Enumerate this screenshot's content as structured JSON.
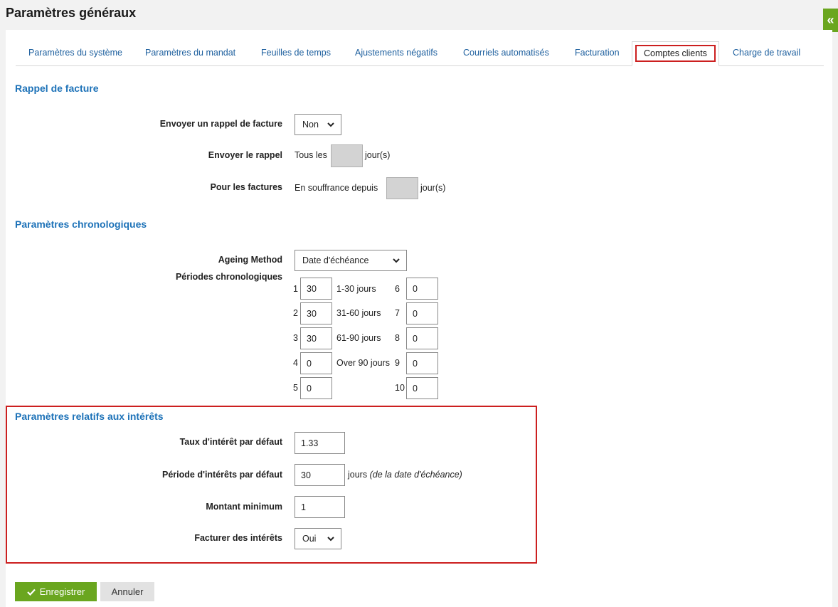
{
  "page": {
    "title": "Paramètres généraux",
    "collapse_icon": "«"
  },
  "tabs": [
    {
      "label": "Paramètres du système",
      "active": false
    },
    {
      "label": "Paramètres du mandat",
      "active": false
    },
    {
      "label": "Feuilles de temps",
      "active": false
    },
    {
      "label": "Ajustements négatifs",
      "active": false
    },
    {
      "label": "Courriels automatisés",
      "active": false
    },
    {
      "label": "Facturation",
      "active": false
    },
    {
      "label": "Comptes clients",
      "active": true
    },
    {
      "label": "Charge de travail",
      "active": false
    }
  ],
  "reminder": {
    "title": "Rappel de facture",
    "send_reminder_label": "Envoyer un rappel de facture",
    "send_reminder_value": "Non",
    "send_every_label": "Envoyer le rappel",
    "send_every_prefix": "Tous les",
    "send_every_value": "",
    "send_every_suffix": "jour(s)",
    "invoices_label": "Pour les factures",
    "invoices_prefix": "En souffrance depuis",
    "invoices_value": "",
    "invoices_suffix": "jour(s)"
  },
  "aging": {
    "title": "Paramètres chronologiques",
    "method_label": "Ageing Method",
    "method_value": "Date d'échéance",
    "periods_label": "Périodes chronologiques",
    "periods": [
      {
        "num": "1",
        "value": "30",
        "desc": "1-30 jours"
      },
      {
        "num": "2",
        "value": "30",
        "desc": "31-60 jours"
      },
      {
        "num": "3",
        "value": "30",
        "desc": "61-90 jours"
      },
      {
        "num": "4",
        "value": "0",
        "desc": "Over 90 jours"
      },
      {
        "num": "5",
        "value": "0",
        "desc": ""
      },
      {
        "num": "6",
        "value": "0",
        "desc": ""
      },
      {
        "num": "7",
        "value": "0",
        "desc": ""
      },
      {
        "num": "8",
        "value": "0",
        "desc": ""
      },
      {
        "num": "9",
        "value": "0",
        "desc": ""
      },
      {
        "num": "10",
        "value": "0",
        "desc": ""
      }
    ]
  },
  "interest": {
    "title": "Paramètres relatifs aux intérêts",
    "rate_label": "Taux d'intérêt par défaut",
    "rate_value": "1.33",
    "period_label": "Période d'intérêts par défaut",
    "period_value": "30",
    "period_suffix": "jours",
    "period_note": "(de la date d'échéance)",
    "min_label": "Montant minimum",
    "min_value": "1",
    "bill_label": "Facturer des intérêts",
    "bill_value": "Oui"
  },
  "actions": {
    "save_label": "Enregistrer",
    "cancel_label": "Annuler"
  }
}
